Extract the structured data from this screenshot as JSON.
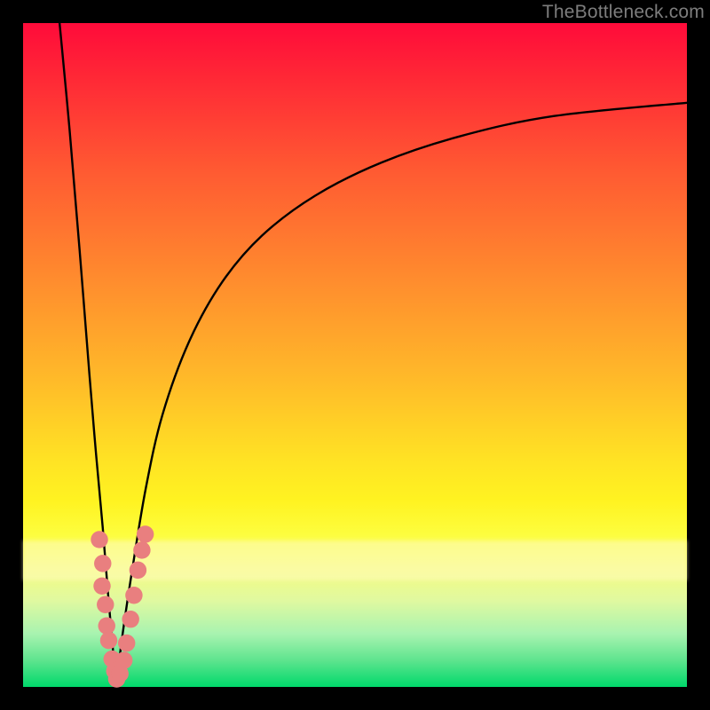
{
  "watermark": "TheBottleneck.com",
  "colors": {
    "curve": "#000000",
    "dot": "#e97f7f",
    "gradient_top": "#ff0b3a",
    "gradient_bottom": "#00d96b"
  },
  "chart_data": {
    "type": "line",
    "title": "",
    "xlabel": "",
    "ylabel": "",
    "xlim": [
      0,
      100
    ],
    "ylim": [
      0,
      100
    ],
    "axes_visible": false,
    "grid": false,
    "background": "vertical-gradient red→orange→yellow→green",
    "description": "Two monotone curve segments that meet at a sharp minimum near x≈14, y≈0. Left segment descends steeply from the top-left corner to the minimum. Right segment rises from the minimum with decreasing slope, asymptotically approaching y≈88 at the right edge. Scatter dots cluster on both branches near the bottom ~22% of the plot.",
    "series": [
      {
        "name": "left-branch",
        "x": [
          5.5,
          7.0,
          8.5,
          10.0,
          11.0,
          12.0,
          12.8,
          13.5,
          14.0
        ],
        "y": [
          100,
          84,
          66,
          47,
          35,
          24,
          14,
          6,
          0
        ]
      },
      {
        "name": "right-branch",
        "x": [
          14.0,
          15.0,
          16.5,
          18.5,
          21.0,
          25.0,
          30.0,
          36.0,
          44.0,
          54.0,
          66.0,
          80.0,
          100.0
        ],
        "y": [
          0,
          8,
          18,
          30,
          41,
          52,
          61,
          68,
          74,
          79,
          83,
          86,
          88
        ]
      }
    ],
    "scatter": {
      "name": "near-minimum-dots",
      "points": [
        {
          "x": 11.5,
          "y": 22.2
        },
        {
          "x": 12.0,
          "y": 18.6
        },
        {
          "x": 11.9,
          "y": 15.2
        },
        {
          "x": 12.4,
          "y": 12.4
        },
        {
          "x": 12.6,
          "y": 9.2
        },
        {
          "x": 12.9,
          "y": 7.0
        },
        {
          "x": 13.4,
          "y": 4.2
        },
        {
          "x": 13.8,
          "y": 2.4
        },
        {
          "x": 14.1,
          "y": 1.2
        },
        {
          "x": 14.6,
          "y": 2.0
        },
        {
          "x": 15.2,
          "y": 4.0
        },
        {
          "x": 15.6,
          "y": 6.6
        },
        {
          "x": 16.2,
          "y": 10.2
        },
        {
          "x": 16.7,
          "y": 13.8
        },
        {
          "x": 17.3,
          "y": 17.6
        },
        {
          "x": 17.9,
          "y": 20.6
        },
        {
          "x": 18.4,
          "y": 23.0
        }
      ],
      "radius_pct": 1.3
    }
  }
}
